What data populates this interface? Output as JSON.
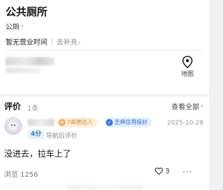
{
  "poi": {
    "name": "公共厕所",
    "category": "公厕",
    "category_chevron": "›",
    "hours_status": "暂无营业时间",
    "hours_separator": "|",
    "hours_add": "去补充",
    "hours_add_chevron": "›"
  },
  "map_button": {
    "label": "地图",
    "icon": "map-pin-icon"
  },
  "reviews": {
    "title": "评价",
    "count": "1条",
    "view_all": "查看全部",
    "view_all_chevron": "›",
    "items": [
      {
        "level_badge": "7高德达人",
        "credit_badge": "芝麻信用极好",
        "date": "2025-10-28",
        "score": "4分",
        "tag": "导航后评价",
        "text": "没进去，拉车上了",
        "views": "浏览 1256",
        "likes": "3",
        "more": "···"
      }
    ]
  },
  "colors": {
    "level_badge_text": "#d48a2a",
    "credit_badge_text": "#2b6fd6",
    "score_text": "#2a7fc6"
  }
}
